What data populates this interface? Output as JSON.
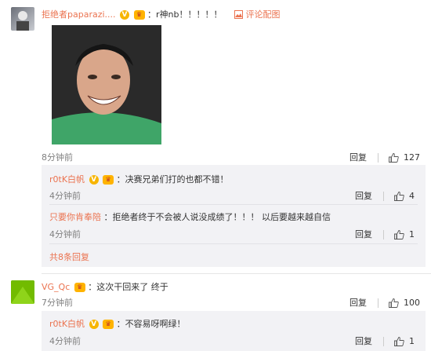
{
  "comments": [
    {
      "username": "拒绝者paparazi....",
      "text": "r神nb！！！！！",
      "attach": "评论配图",
      "time": "8分钟前",
      "reply_label": "回复",
      "likes": "127"
    },
    {
      "username": "VG_Qc",
      "text": "这次干回来了 终于",
      "time": "7分钟前",
      "reply_label": "回复",
      "likes": "100"
    }
  ],
  "replies_1": [
    {
      "username": "r0tK白帆",
      "text": "决赛兄弟们打的也都不错！",
      "time": "4分钟前",
      "reply_label": "回复",
      "likes": "4"
    },
    {
      "username": "只要你肯奉陪",
      "text": "拒绝者终于不会被人说没成绩了！！！ 以后要越来越自信",
      "time": "4分钟前",
      "reply_label": "回复",
      "likes": "1"
    }
  ],
  "more_replies": "共8条回复",
  "replies_2": [
    {
      "username": "r0tK白帆",
      "text": "不容易呀啊绿！",
      "time": "4分钟前",
      "reply_label": "回复",
      "likes": "1"
    }
  ],
  "badge_v": "V",
  "badge_crown": "♛",
  "colors": {
    "link": "#eb7350",
    "reply_bg": "#f2f2f5",
    "gray": "#808080"
  }
}
